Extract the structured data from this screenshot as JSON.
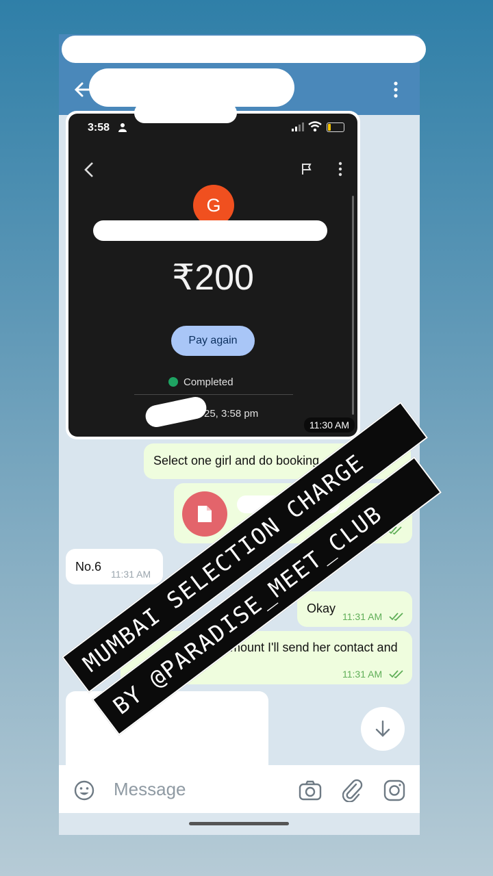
{
  "shot": {
    "status_time": "3:58",
    "avatar_letter": "G",
    "amount": "₹200",
    "pay_again": "Pay again",
    "status": "Completed",
    "datetime_partial": "25, 3:58 pm",
    "timestamp": "11:30 AM"
  },
  "messages": [
    {
      "text": "Select one girl and do booking"
    },
    {
      "text": "No.6",
      "time": "11:31 AM"
    },
    {
      "text": "Okay",
      "time": "11:31 AM"
    },
    {
      "text": "amount I'll send her contact and",
      "time": "11:31 AM"
    }
  ],
  "input": {
    "placeholder": "Message"
  },
  "overlay": {
    "line1": "MUMBAI SELECTION CHARGE",
    "line2": "BY @PARADISE_MEET_CLUB"
  },
  "colors": {
    "header": "#4a88ba",
    "outgoing_bubble": "#effdde",
    "avatar": "#f0501f",
    "button": "#a9c6f7"
  }
}
